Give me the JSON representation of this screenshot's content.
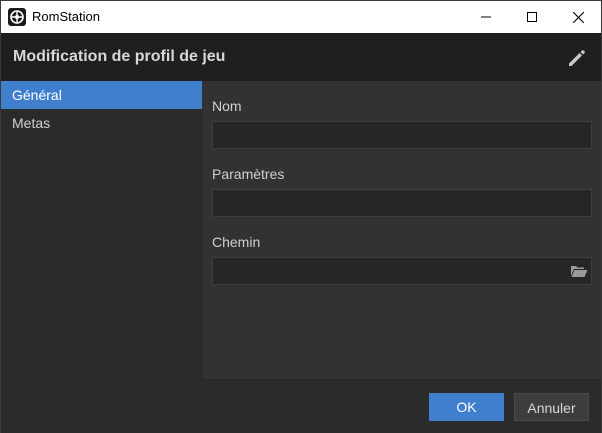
{
  "window": {
    "title": "RomStation",
    "controls": {
      "minimize_icon": "minimize-icon",
      "maximize_icon": "maximize-icon",
      "close_icon": "close-icon"
    }
  },
  "header": {
    "title": "Modification de profil de jeu",
    "edit_icon": "pencil-icon"
  },
  "sidebar": {
    "items": [
      {
        "label": "Général",
        "active": true
      },
      {
        "label": "Metas",
        "active": false
      }
    ]
  },
  "form": {
    "fields": [
      {
        "label": "Nom",
        "value": "",
        "placeholder": ""
      },
      {
        "label": "Paramètres",
        "value": "",
        "placeholder": ""
      },
      {
        "label": "Chemin",
        "value": "",
        "placeholder": "",
        "browse_icon": "folder-open-icon"
      }
    ]
  },
  "footer": {
    "ok_label": "OK",
    "cancel_label": "Annuler"
  },
  "colors": {
    "accent": "#3f7fce",
    "background": "#2f2f2f",
    "header_bg": "#1f1f1f",
    "sidebar_bg": "#2a2a2a",
    "input_bg": "#262626"
  }
}
